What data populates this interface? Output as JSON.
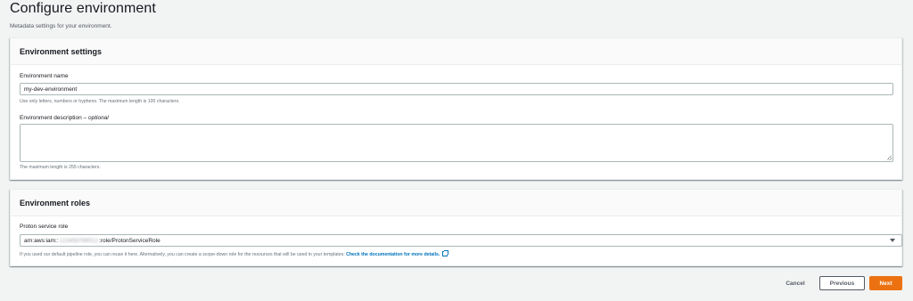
{
  "page": {
    "title": "Configure environment",
    "subtitle": "Metadata settings for your environment."
  },
  "settings": {
    "heading": "Environment settings",
    "name_label": "Environment name",
    "name_value": "my-dev-environment",
    "name_hint": "Use only letters, numbers or hyphens. The maximum length is 100 characters.",
    "desc_label": "Environment description",
    "desc_optional": "optional",
    "desc_separator": " – ",
    "desc_value": "",
    "desc_hint": "The maximum length is 255 characters."
  },
  "roles": {
    "heading": "Environment roles",
    "role_label": "Proton service role",
    "role_prefix": "arn:aws:iam::",
    "role_masked": "123456789012",
    "role_suffix": ":role/ProtonServiceRole",
    "role_hint": "If you used our default pipeline role, you can reuse it here. Alternatively, you can create a scope-down role for the resources that will be used in your templates.",
    "role_link": "Check the documentation for more details."
  },
  "footer": {
    "cancel_label": "Cancel",
    "previous_label": "Previous",
    "next_label": "Next"
  },
  "colors": {
    "primary_button": "#ec7211",
    "link": "#0073bb",
    "background": "#f2f3f3"
  }
}
